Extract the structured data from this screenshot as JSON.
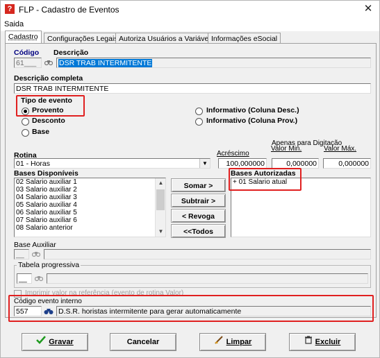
{
  "window": {
    "title": "FLP - Cadastro de Eventos",
    "icon_letter": "?"
  },
  "menu": {
    "items": [
      "Saida"
    ]
  },
  "tabs": [
    "Cadastro",
    "Configurações Legais",
    "Autoriza Usuários a Variáveis",
    "Informações eSocial"
  ],
  "cadastro": {
    "codigo_label": "Código",
    "descricao_label": "Descrição",
    "codigo_value": "61",
    "descricao_value": "DSR TRAB INTERMITENTE",
    "descricao_completa_label": "Descrição completa",
    "descricao_completa_value": "DSR TRAB INTERMITENTE"
  },
  "tipo_evento": {
    "label": "Tipo de evento",
    "options": [
      "Provento",
      "Desconto",
      "Base",
      "Informativo (Coluna Desc.)",
      "Informativo (Coluna Prov.)"
    ],
    "selected": "Provento"
  },
  "rotina": {
    "label": "Rotina",
    "value": "01 - Horas",
    "acrescimo_label": "Acréscimo",
    "acrescimo_value": "100,000000",
    "apenas_label": "Apenas para Digitação",
    "valor_min_label": "Valor Min.",
    "valor_min_value": "0,000000",
    "valor_max_label": "Valor Máx.",
    "valor_max_value": "0,000000"
  },
  "bases": {
    "disponiveis_label": "Bases Disponíveis",
    "disponiveis": [
      "02 Salario auxiliar 1",
      "03 Salario auxiliar 2",
      "04 Salario auxiliar 3",
      "05 Salario auxiliar 4",
      "06 Salario auxiliar 5",
      "07 Salario auxiliar 6",
      "08 Salario anterior"
    ],
    "autorizadas_label": "Bases Autorizadas",
    "autorizadas": [
      "+ 01 Salario atual"
    ],
    "somar_label": "Somar >",
    "subtrair_label": "Subtrair >",
    "revoga_label": "< Revoga",
    "todos_label": "<<Todos"
  },
  "base_auxiliar": {
    "label": "Base Auxiliar"
  },
  "tabela": {
    "label": "Tabela progressiva",
    "checkbox_label": "Imprimir valor na referência (evento de rotina Valor)"
  },
  "codigo_interno": {
    "label": "Código evento interno",
    "code": "557",
    "description": "D.S.R. horistas intermitente para gerar automaticamente"
  },
  "footer": {
    "gravar": "Gravar",
    "cancelar": "Cancelar",
    "limpar": "Limpar",
    "excluir": "Excluir"
  },
  "colors": {
    "highlight": "#e02020",
    "selection": "#0078d7",
    "label_navy": "#000080"
  }
}
